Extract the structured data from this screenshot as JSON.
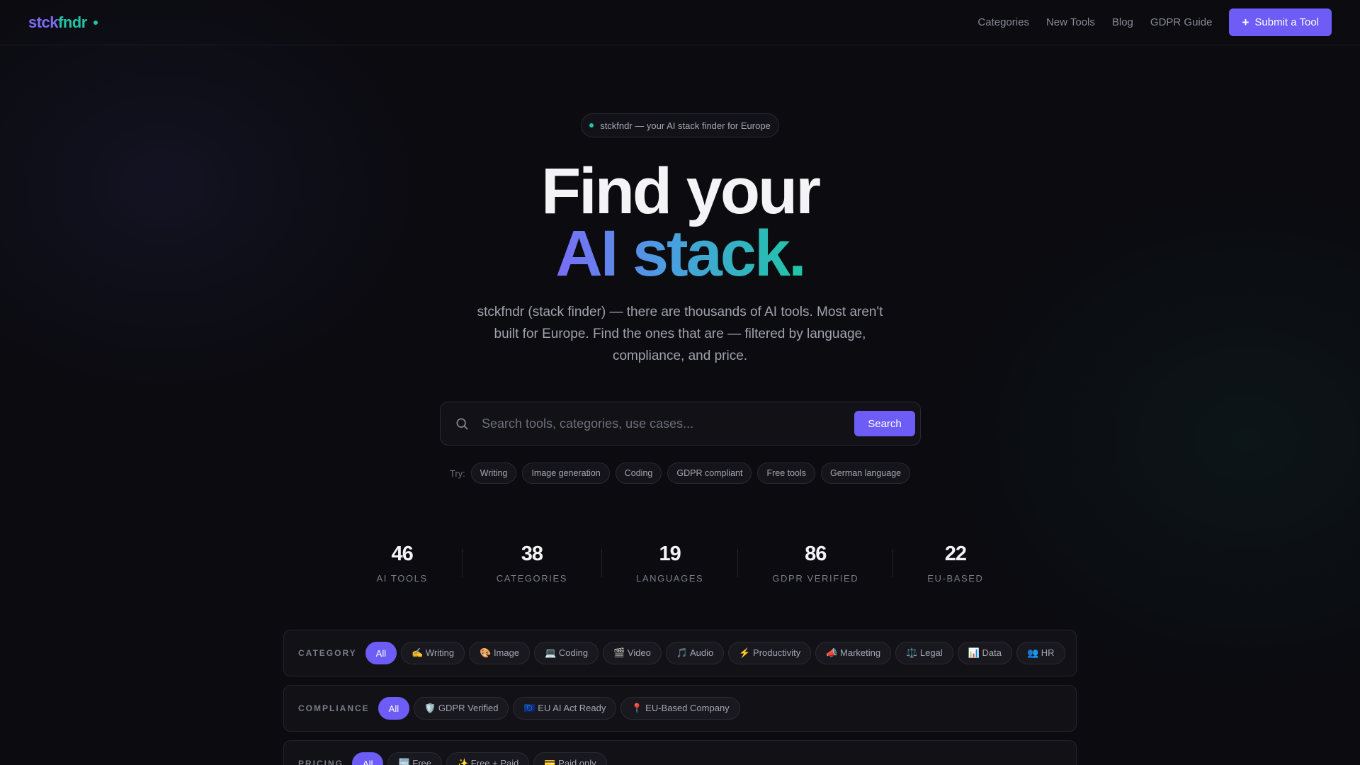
{
  "nav": {
    "logo_part1": "stck",
    "logo_part2": "fndr",
    "links": [
      "Categories",
      "New Tools",
      "Blog",
      "GDPR Guide"
    ],
    "submit_label": "Submit a Tool"
  },
  "hero": {
    "badge": "stckfndr — your AI stack finder for Europe",
    "title_line1": "Find your",
    "title_line2": "AI stack.",
    "subtitle": "stckfndr (stack finder) — there are thousands of AI tools. Most aren't built for Europe. Find the ones that are — filtered by language, compliance, and price."
  },
  "search": {
    "placeholder": "Search tools, categories, use cases...",
    "button": "Search",
    "try_label": "Try:",
    "suggestions": [
      "Writing",
      "Image generation",
      "Coding",
      "GDPR compliant",
      "Free tools",
      "German language"
    ]
  },
  "stats": [
    {
      "value": "46",
      "label": "AI TOOLS"
    },
    {
      "value": "38",
      "label": "CATEGORIES"
    },
    {
      "value": "19",
      "label": "LANGUAGES"
    },
    {
      "value": "86",
      "label": "GDPR VERIFIED"
    },
    {
      "value": "22",
      "label": "EU-BASED"
    }
  ],
  "filters": {
    "category": {
      "label": "CATEGORY",
      "options": [
        "All",
        "✍️ Writing",
        "🎨 Image",
        "💻 Coding",
        "🎬 Video",
        "🎵 Audio",
        "⚡ Productivity",
        "📣 Marketing",
        "⚖️ Legal",
        "📊 Data",
        "👥 HR"
      ]
    },
    "compliance": {
      "label": "COMPLIANCE",
      "options": [
        "All",
        "🛡️ GDPR Verified",
        "🇪🇺 EU AI Act Ready",
        "📍 EU-Based Company"
      ]
    },
    "pricing": {
      "label": "PRICING",
      "options": [
        "All",
        "🆓 Free",
        "✨ Free + Paid",
        "💳 Paid only"
      ]
    }
  },
  "colors": {
    "accent": "#6d5df6",
    "teal": "#22c4a8",
    "background": "#0b0b10"
  }
}
